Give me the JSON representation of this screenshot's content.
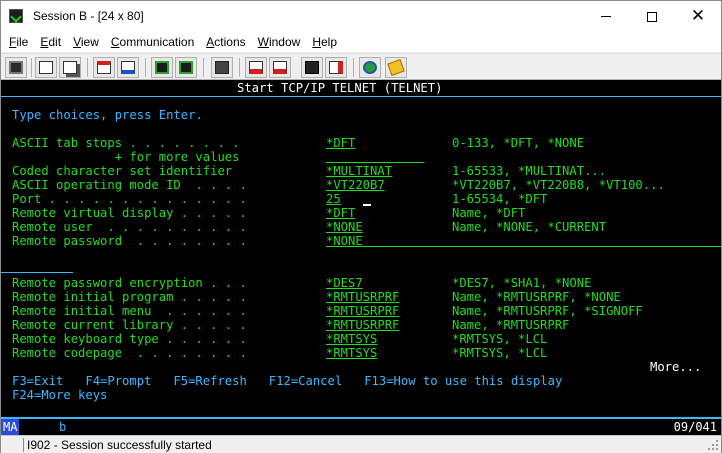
{
  "window": {
    "title": "Session B - [24 x 80]"
  },
  "menu": {
    "items": [
      {
        "label": "File",
        "accel": "F",
        "rest": "ile"
      },
      {
        "label": "Edit",
        "accel": "E",
        "rest": "dit"
      },
      {
        "label": "View",
        "accel": "V",
        "rest": "iew"
      },
      {
        "label": "Communication",
        "accel": "C",
        "rest": "ommunication"
      },
      {
        "label": "Actions",
        "accel": "A",
        "rest": "ctions"
      },
      {
        "label": "Window",
        "accel": "W",
        "rest": "indow"
      },
      {
        "label": "Help",
        "accel": "H",
        "rest": "elp"
      }
    ]
  },
  "toolbar": {
    "icons": [
      "print-screen-icon",
      "copy-icon",
      "paste-icon",
      "send-file-icon",
      "receive-file-icon",
      "display-setup-icon",
      "keyboard-map-icon",
      "macro-record-icon",
      "macro-play-icon",
      "macro-stop-icon",
      "macro-run-icon",
      "globe-icon",
      "edit-notes-icon"
    ]
  },
  "terminal": {
    "screen_title": "Start TCP/IP TELNET (TELNET)",
    "instruction": "Type choices, press Enter.",
    "rows": [
      {
        "label": "ASCII tab stops . . . . . . . .",
        "value": "*DFT",
        "help": "0-133, *DFT, *NONE"
      },
      {
        "label": "              + for more values",
        "value": "",
        "help": ""
      },
      {
        "label": "Coded character set identifier",
        "value": "*MULTINAT",
        "help": "1-65533, *MULTINAT..."
      },
      {
        "label": "ASCII operating mode ID  . . . .",
        "value": "*VT220B7",
        "help": "*VT220B7, *VT220B8, *VT100..."
      },
      {
        "label": "Port . . . . . . . . . . . . . .",
        "value": "25",
        "help": "1-65534, *DFT"
      },
      {
        "label": "Remote virtual display . . . . .",
        "value": "*DFT",
        "help": "Name, *DFT"
      },
      {
        "label": "Remote user  . . . . . . . . . .",
        "value": "*NONE",
        "help": "Name, *NONE, *CURRENT"
      },
      {
        "label": "Remote password  . . . . . . . .",
        "value": "*NONE",
        "help": ""
      },
      {
        "label": "Remote password encryption . . .",
        "value": "*DES7",
        "help": "*DES7, *SHA1, *NONE"
      },
      {
        "label": "Remote initial program . . . . .",
        "value": "*RMTUSRPRF",
        "help": "Name, *RMTUSRPRF, *NONE"
      },
      {
        "label": "Remote initial menu  . . . . . .",
        "value": "*RMTUSRPRF",
        "help": "Name, *RMTUSRPRF, *SIGNOFF"
      },
      {
        "label": "Remote current library . . . . .",
        "value": "*RMTUSRPRF",
        "help": "Name, *RMTUSRPRF"
      },
      {
        "label": "Remote keyboard type . . . . . .",
        "value": "*RMTSYS",
        "help": "*RMTSYS, *LCL"
      },
      {
        "label": "Remote codepage  . . . . . . . .",
        "value": "*RMTSYS",
        "help": "*RMTSYS, *LCL"
      }
    ],
    "more": "More...",
    "fkeys_line1": "F3=Exit   F4=Prompt   F5=Refresh   F12=Cancel   F13=How to use this display",
    "fkeys_line2": "F24=More keys"
  },
  "oia": {
    "mode": "MA",
    "indicator": "b",
    "cursor_pos": "09/041"
  },
  "status": {
    "message": "I902 - Session successfully started"
  },
  "colors": {
    "terminal_bg": "#000000",
    "field_green": "#22dc22",
    "accent_blue": "#3ab8ff",
    "oia_highlight": "#2a4bd7"
  }
}
